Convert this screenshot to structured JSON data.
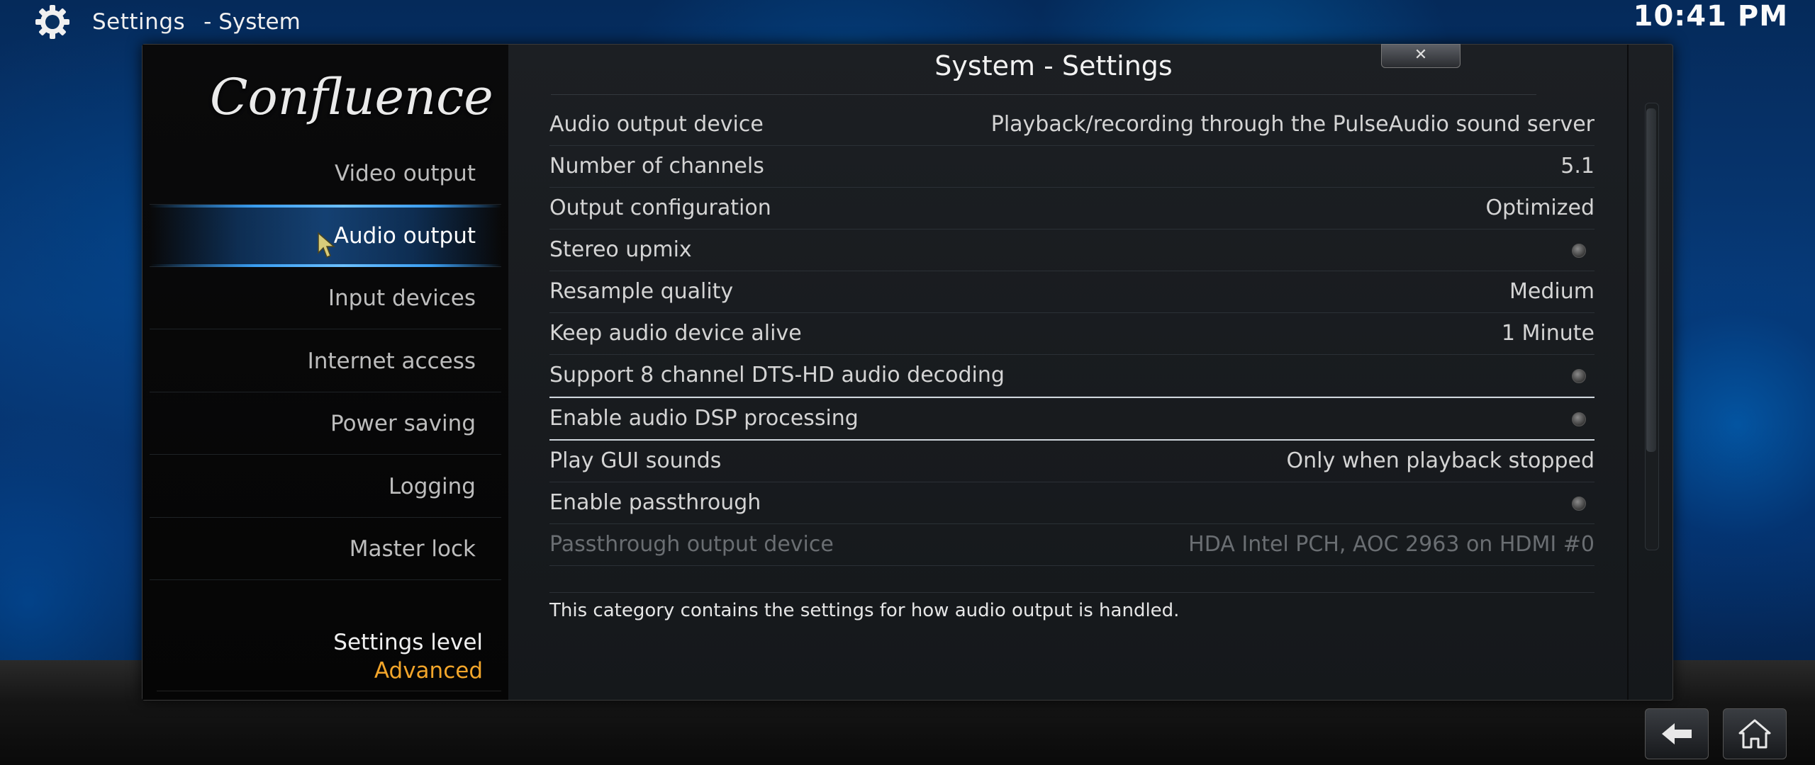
{
  "header": {
    "title": "Settings",
    "subtitle": "- System",
    "clock": "10:41 PM",
    "icon": "gear-icon"
  },
  "sidebar": {
    "logo": "Confluence",
    "items": [
      {
        "label": "Video output",
        "active": false
      },
      {
        "label": "Audio output",
        "active": true
      },
      {
        "label": "Input devices",
        "active": false
      },
      {
        "label": "Internet access",
        "active": false
      },
      {
        "label": "Power saving",
        "active": false
      },
      {
        "label": "Logging",
        "active": false
      },
      {
        "label": "Master lock",
        "active": false
      }
    ],
    "settings_level_label": "Settings level",
    "settings_level_value": "Advanced"
  },
  "content": {
    "title": "System - Settings",
    "close_label": "✕",
    "settings": [
      {
        "label": "Audio output device",
        "value": "Playback/recording through the PulseAudio sound server",
        "type": "value"
      },
      {
        "label": "Number of channels",
        "value": "5.1",
        "type": "value"
      },
      {
        "label": "Output configuration",
        "value": "Optimized",
        "type": "value"
      },
      {
        "label": "Stereo upmix",
        "value": "",
        "type": "toggle"
      },
      {
        "label": "Resample quality",
        "value": "Medium",
        "type": "value"
      },
      {
        "label": "Keep audio device alive",
        "value": "1 Minute",
        "type": "value"
      },
      {
        "label": "Support 8 channel DTS-HD audio decoding",
        "value": "",
        "type": "toggle"
      },
      {
        "label": "Enable audio DSP processing",
        "value": "",
        "type": "toggle",
        "selected": true
      },
      {
        "label": "Play GUI sounds",
        "value": "Only when playback stopped",
        "type": "value"
      },
      {
        "label": "Enable passthrough",
        "value": "",
        "type": "toggle"
      },
      {
        "label": "Passthrough output device",
        "value": "HDA Intel PCH, AOC 2963 on HDMI #0",
        "type": "value",
        "disabled": true
      }
    ],
    "description": "This category contains the settings for how audio output is handled."
  },
  "footer": {
    "back_icon": "back-arrow-icon",
    "home_icon": "home-icon"
  },
  "colors": {
    "accent": "#f2a52a",
    "highlight": "#3a9df0"
  }
}
